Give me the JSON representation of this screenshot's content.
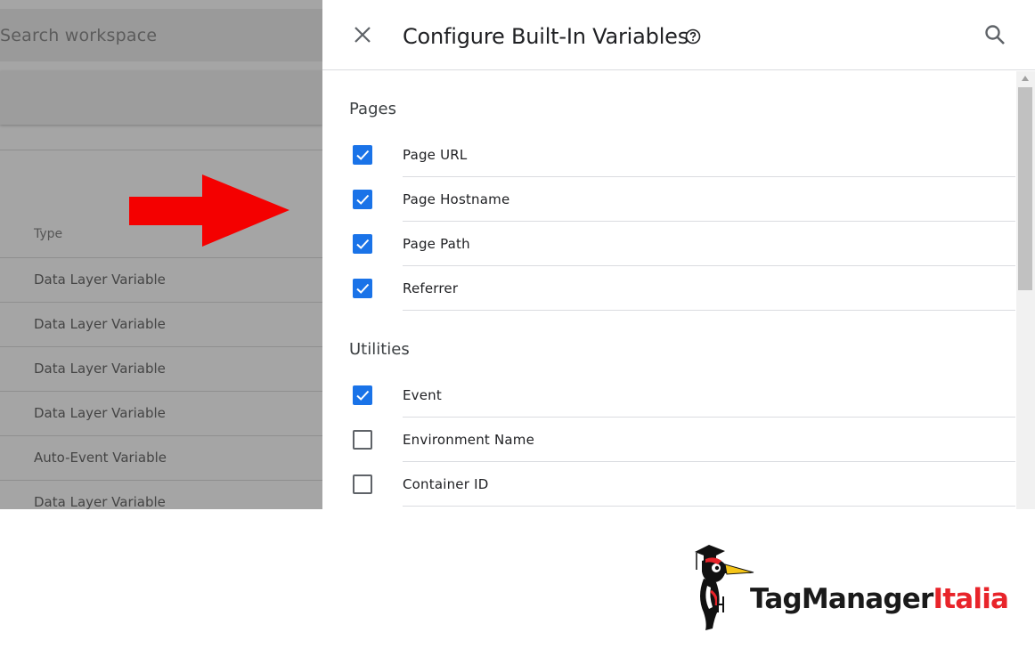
{
  "background": {
    "search_placeholder": "Search workspace",
    "type_header": "Type",
    "type_rows": [
      "Data Layer Variable",
      "Data Layer Variable",
      "Data Layer Variable",
      "Data Layer Variable",
      "Auto-Event Variable",
      "Data Layer Variable"
    ]
  },
  "panel": {
    "title": "Configure Built-In Variables",
    "sections": [
      {
        "title": "Pages",
        "items": [
          {
            "label": "Page URL",
            "checked": true
          },
          {
            "label": "Page Hostname",
            "checked": true
          },
          {
            "label": "Page Path",
            "checked": true
          },
          {
            "label": "Referrer",
            "checked": true
          }
        ]
      },
      {
        "title": "Utilities",
        "items": [
          {
            "label": "Event",
            "checked": true
          },
          {
            "label": "Environment Name",
            "checked": false
          },
          {
            "label": "Container ID",
            "checked": false
          }
        ]
      }
    ]
  },
  "logo": {
    "part1": "TagManager",
    "part2": "Italia"
  },
  "colors": {
    "accent": "#1a73e8",
    "arrow": "#f40000",
    "brand_red": "#e8242a"
  },
  "icons": [
    "close-icon",
    "help-icon",
    "search-icon",
    "checkbox-icon",
    "arrow-right-icon",
    "woodpecker-logo-icon"
  ]
}
